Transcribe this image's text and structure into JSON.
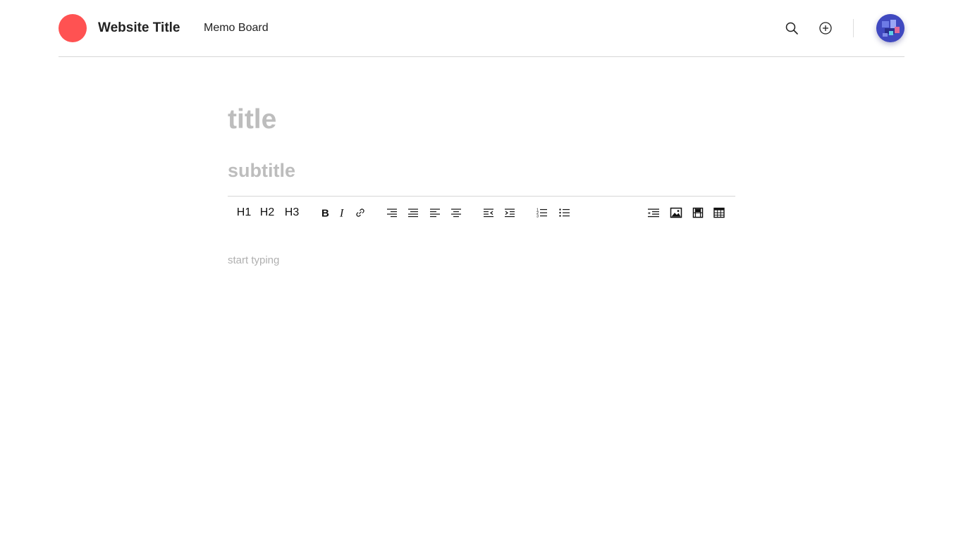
{
  "header": {
    "site_title": "Website Title",
    "nav_link": "Memo Board",
    "logo_color": "#ff5252",
    "icons": [
      "search-icon",
      "add-circle-icon"
    ]
  },
  "editor": {
    "title_placeholder": "title",
    "subtitle_placeholder": "subtitle",
    "body_placeholder": "start typing",
    "toolbar": {
      "heading_buttons": [
        "H1",
        "H2",
        "H3"
      ],
      "tool_icons": [
        "bold-icon",
        "italic-icon",
        "link-icon",
        "align-right-icon",
        "align-justify-icon",
        "align-left-icon",
        "align-center-icon",
        "outdent-icon",
        "indent-icon",
        "ordered-list-icon",
        "unordered-list-icon",
        "blockquote-icon",
        "image-icon",
        "video-icon",
        "table-icon"
      ]
    }
  }
}
